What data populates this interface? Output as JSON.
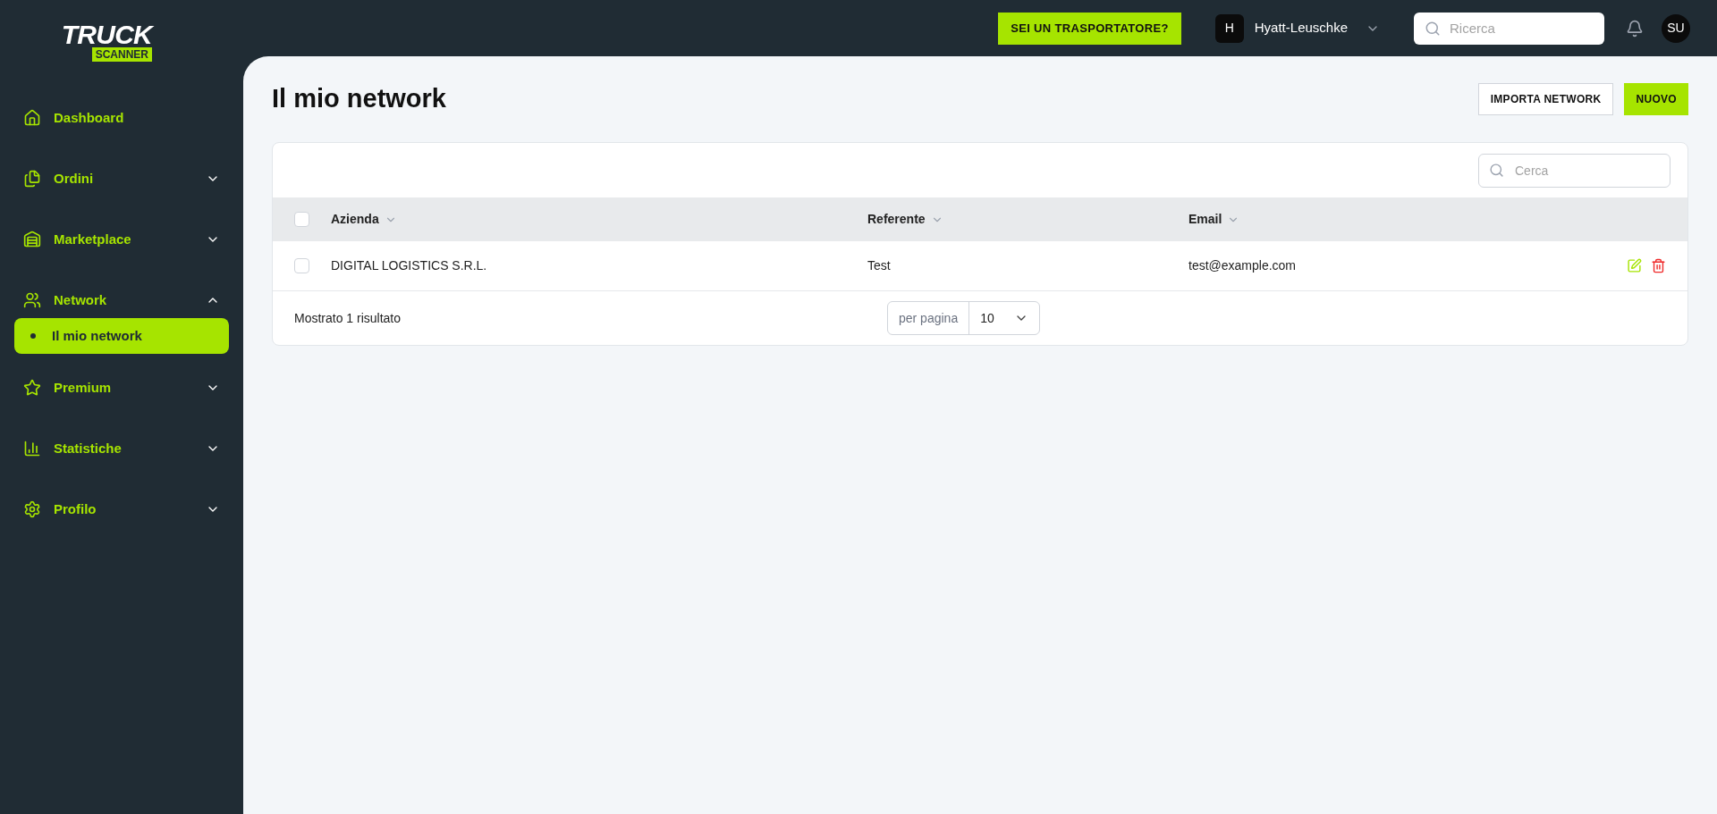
{
  "logo": {
    "word": "TRUCK",
    "sub": "SCANNER"
  },
  "sidebar": {
    "items": [
      {
        "label": "Dashboard",
        "selected": false
      },
      {
        "label": "Ordini",
        "selected": false,
        "expanded": false
      },
      {
        "label": "Marketplace",
        "selected": false,
        "expanded": false
      },
      {
        "label": "Network",
        "selected": false,
        "expanded": true,
        "children": [
          {
            "label": "Il mio network",
            "selected": true
          }
        ]
      },
      {
        "label": "Premium",
        "selected": false,
        "expanded": false
      },
      {
        "label": "Statistiche",
        "selected": false,
        "expanded": false
      },
      {
        "label": "Profilo",
        "selected": false,
        "expanded": false
      }
    ]
  },
  "topbar": {
    "cta": "SEI UN TRASPORTATORE?",
    "company": {
      "initial": "H",
      "name": "Hyatt-Leuschke"
    },
    "search": {
      "placeholder": "Ricerca"
    },
    "avatar": "SU"
  },
  "page": {
    "title": "Il mio network",
    "buttons": [
      "IMPORTA NETWORK",
      "NUOVO"
    ]
  },
  "table": {
    "search": {
      "placeholder": "Cerca"
    },
    "select_all": {
      "checked": false
    },
    "columns": [
      "Azienda",
      "Referente",
      "Email"
    ],
    "rows": [
      {
        "checked": false,
        "cells": [
          "DIGITAL LOGISTICS S.R.L.",
          "Test",
          "test@example.com"
        ]
      }
    ],
    "footer": {
      "summary": "Mostrato 1 risultato",
      "per_page_label": "per pagina",
      "per_page": "10"
    }
  }
}
